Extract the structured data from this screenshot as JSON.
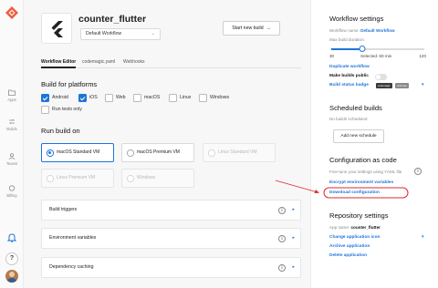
{
  "nav": {
    "items": [
      {
        "label": "Apps",
        "icon": "folder-icon"
      },
      {
        "label": "Builds",
        "icon": "builds-icon"
      },
      {
        "label": "Teams",
        "icon": "team-icon"
      },
      {
        "label": "Billing",
        "icon": "billing-icon"
      }
    ],
    "help_label": "?"
  },
  "header": {
    "app_name": "counter_flutter",
    "workflow_selected": "Default Workflow",
    "start_build_label": "Start new build"
  },
  "tabs": [
    "Workflow Editor",
    "codemagic.yaml",
    "Webhooks"
  ],
  "build_for": {
    "title": "Build for platforms",
    "platforms": [
      {
        "label": "Android",
        "checked": true
      },
      {
        "label": "iOS",
        "checked": true
      },
      {
        "label": "Web",
        "checked": false
      },
      {
        "label": "macOS",
        "checked": false
      },
      {
        "label": "Linux",
        "checked": false
      },
      {
        "label": "Windows",
        "checked": false
      }
    ],
    "run_tests_label": "Run tests only"
  },
  "run_on": {
    "title": "Run build on",
    "options": [
      {
        "label": "macOS Standard VM",
        "state": "selected"
      },
      {
        "label": "macOS Premium VM",
        "state": "available"
      },
      {
        "label": "Linux Standard VM",
        "state": "disabled"
      },
      {
        "label": "Linux Premium VM",
        "state": "disabled"
      },
      {
        "label": "Windows",
        "state": "disabled"
      }
    ]
  },
  "sections": [
    {
      "label": "Build triggers"
    },
    {
      "label": "Environment variables"
    },
    {
      "label": "Dependency caching"
    }
  ],
  "workflow_settings": {
    "title": "Workflow settings",
    "workflow_name_label": "Workflow name:",
    "workflow_name_value": "Default Workflow",
    "max_duration_label": "Max build duration:",
    "slider_min": "30",
    "slider_selected": "Selected: 60 min",
    "slider_max": "120",
    "slider_fraction": 0.33,
    "duplicate_label": "Duplicate workflow",
    "make_public_label": "Make builds public",
    "status_badge_label": "Build status badge",
    "badge_left": "codemagic",
    "badge_right": "unknown"
  },
  "scheduled_builds": {
    "title": "Scheduled builds",
    "empty_text": "No builds scheduled",
    "add_label": "Add new schedule"
  },
  "config_as_code": {
    "title": "Configuration as code",
    "description": "Fine-tune your settings using YAML file",
    "encrypt_label": "Encrypt environment variables",
    "download_label": "Download configuration"
  },
  "repository_settings": {
    "title": "Repository settings",
    "app_name_label": "App name:",
    "app_name_value": "counter_flutter",
    "change_icon_label": "Change application icon",
    "archive_label": "Archive application",
    "delete_label": "Delete application"
  },
  "colors": {
    "accent": "#1f74d8",
    "annotation": "#e0282e",
    "logo": "#f05a3c"
  }
}
